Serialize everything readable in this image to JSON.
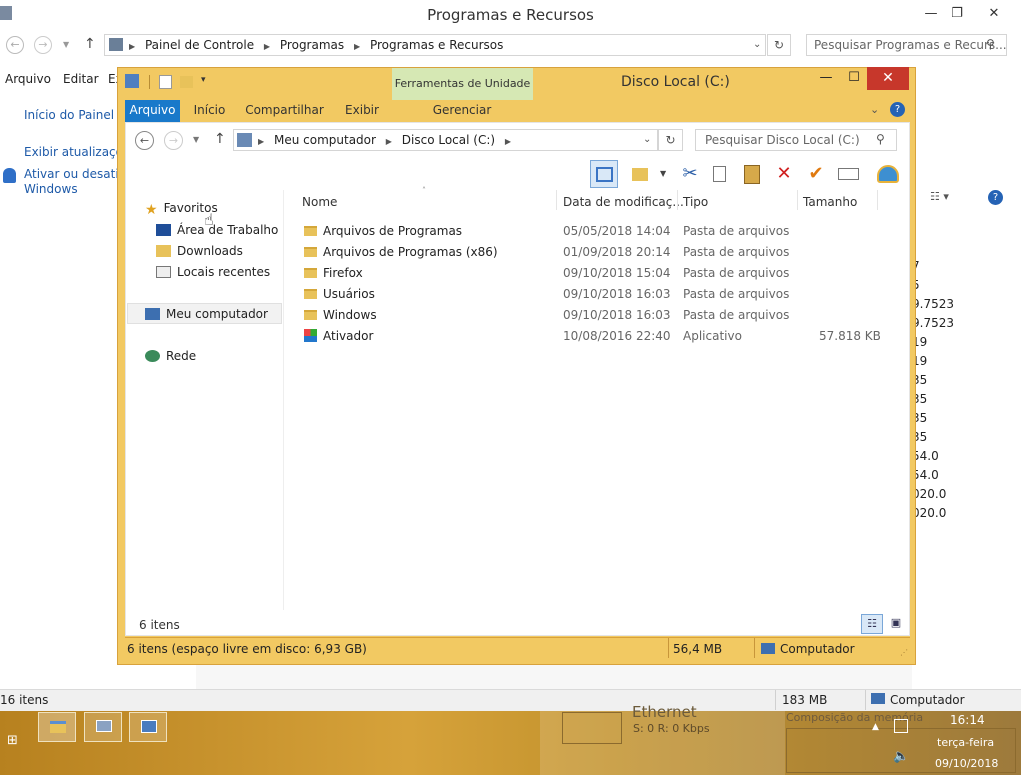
{
  "background_window": {
    "title": "Programas e Recursos",
    "breadcrumb": [
      "Painel de Controle",
      "Programas",
      "Programas e Recursos"
    ],
    "search_placeholder": "Pesquisar Programas e Recurs...",
    "menu": [
      "Arquivo",
      "Editar",
      "Ex"
    ],
    "left_links": [
      "Início do Painel de",
      "Exibir atualizações",
      "Ativar ou desativa",
      "Windows"
    ],
    "version_values": [
      "7",
      "5",
      "9.7523",
      "9.7523",
      "19",
      "19",
      "35",
      "35",
      "35",
      "35",
      "54.0",
      "54.0",
      "020.0",
      "020.0"
    ],
    "status": {
      "items": "16 itens",
      "size": "183 MB",
      "computer": "Computador"
    }
  },
  "explorer_window": {
    "title": "Disco Local (C:)",
    "contextual_tab": "Ferramentas de Unidade",
    "tabs": [
      "Arquivo",
      "Início",
      "Compartilhar",
      "Exibir",
      "Gerenciar"
    ],
    "breadcrumb": [
      "Meu computador",
      "Disco Local (C:)"
    ],
    "search_placeholder": "Pesquisar Disco Local (C:)",
    "nav": {
      "favoritos": "Favoritos",
      "area_trabalho": "Área de Trabalho",
      "downloads": "Downloads",
      "locais": "Locais recentes",
      "computador": "Meu computador",
      "rede": "Rede"
    },
    "columns": [
      "Nome",
      "Data de modificaç...",
      "Tipo",
      "Tamanho"
    ],
    "files": [
      {
        "name": "Arquivos de Programas",
        "date": "05/05/2018 14:04",
        "type": "Pasta de arquivos",
        "size": "",
        "icon": "folder-icon"
      },
      {
        "name": "Arquivos de Programas (x86)",
        "date": "01/09/2018 20:14",
        "type": "Pasta de arquivos",
        "size": "",
        "icon": "folder-icon"
      },
      {
        "name": "Firefox",
        "date": "09/10/2018 15:04",
        "type": "Pasta de arquivos",
        "size": "",
        "icon": "folder-icon"
      },
      {
        "name": "Usuários",
        "date": "09/10/2018 16:03",
        "type": "Pasta de arquivos",
        "size": "",
        "icon": "folder-icon"
      },
      {
        "name": "Windows",
        "date": "09/10/2018 16:03",
        "type": "Pasta de arquivos",
        "size": "",
        "icon": "folder-icon"
      },
      {
        "name": "Ativador",
        "date": "10/08/2016 22:40",
        "type": "Aplicativo",
        "size": "57.818 KB",
        "icon": "app-icon"
      }
    ],
    "item_count": "6 itens",
    "status": {
      "left": "6 itens (espaço livre em disco: 6,93 GB)",
      "size": "56,4 MB",
      "computer": "Computador"
    }
  },
  "taskbar": {
    "network_title": "Ethernet",
    "network_rate": "S: 0 R: 0 Kbps",
    "memory_label": "Composição da memória",
    "time": "16:14",
    "weekday": "terça-feira",
    "date": "09/10/2018"
  },
  "colors": {
    "accent_tab": "#1979ca",
    "frame": "#f2c962",
    "close": "#c7372b",
    "taskbar": "#c99a36"
  }
}
